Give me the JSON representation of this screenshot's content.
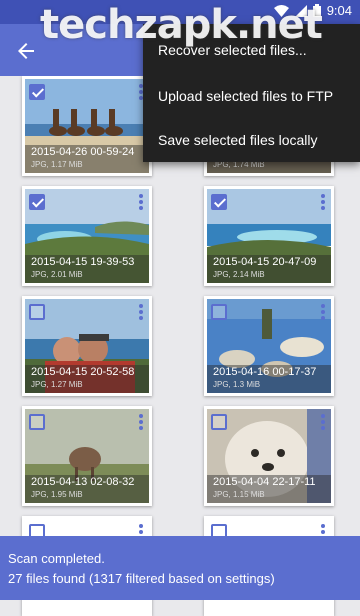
{
  "watermark": "techzapk.net",
  "status_bar": {
    "time": "9:04"
  },
  "menu": {
    "items": [
      "Recover selected files...",
      "Upload selected files to FTP",
      "Save selected files locally"
    ]
  },
  "files": [
    {
      "date": "2015-04-26 00-59-24",
      "meta": "JPG, 1.17 MiB",
      "checked": true
    },
    {
      "date": "",
      "meta": "JPG, 1.74 MiB",
      "checked": false
    },
    {
      "date": "2015-04-15 19-39-53",
      "meta": "JPG, 2.01 MiB",
      "checked": true
    },
    {
      "date": "2015-04-15 20-47-09",
      "meta": "JPG, 2.14 MiB",
      "checked": true
    },
    {
      "date": "2015-04-15 20-52-58",
      "meta": "JPG, 1.27 MiB",
      "checked": false
    },
    {
      "date": "2015-04-16 00-17-37",
      "meta": "JPG, 1.3 MiB",
      "checked": false
    },
    {
      "date": "2015-04-13 02-08-32",
      "meta": "JPG, 1.95 MiB",
      "checked": false
    },
    {
      "date": "2015-04-04 22-17-11",
      "meta": "JPG, 1.15 MiB",
      "checked": false
    }
  ],
  "bottom_bar": {
    "line1": "Scan completed.",
    "line2": "27 files found (1317 filtered based on settings)"
  },
  "colors": {
    "status": "#3f51b5",
    "primary": "#5b6ecf",
    "menu": "#222222"
  },
  "icons": [
    "back-arrow-icon",
    "wifi-icon",
    "signal-icon",
    "battery-icon",
    "more-vert-icon"
  ]
}
